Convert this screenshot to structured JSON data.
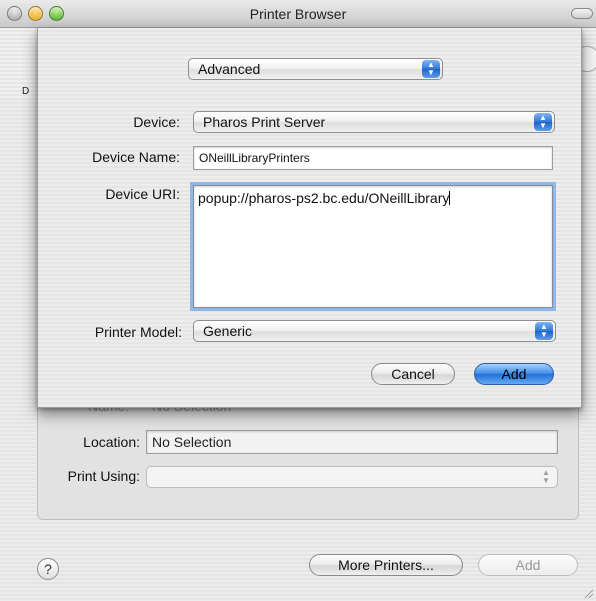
{
  "window": {
    "title": "Printer Browser"
  },
  "background": {
    "column_label_partial": "D",
    "name_label_partial": "Name:",
    "name_value_partial": "No Selection",
    "location_label": "Location:",
    "location_value": "No Selection",
    "print_using_label": "Print Using:",
    "print_using_value": "",
    "help_label": "?",
    "more_printers_label": "More Printers...",
    "add_label": "Add"
  },
  "sheet": {
    "mode_popup": {
      "value": "Advanced"
    },
    "device": {
      "label": "Device:",
      "value": "Pharos Print Server"
    },
    "device_name": {
      "label": "Device Name:",
      "value": "ONeillLibraryPrinters"
    },
    "device_uri": {
      "label": "Device URI:",
      "value": "popup://pharos-ps2.bc.edu/ONeillLibrary"
    },
    "printer_model": {
      "label": "Printer Model:",
      "value": "Generic"
    },
    "buttons": {
      "cancel": "Cancel",
      "add": "Add"
    }
  },
  "icons": {
    "popup_arrows": "up-down-arrows-icon",
    "help": "help-icon",
    "window_controls": [
      "close-icon",
      "minimize-icon",
      "zoom-icon"
    ]
  },
  "colors": {
    "accent_blue": "#3e8ce8",
    "focus_ring": "#8db8ec"
  }
}
